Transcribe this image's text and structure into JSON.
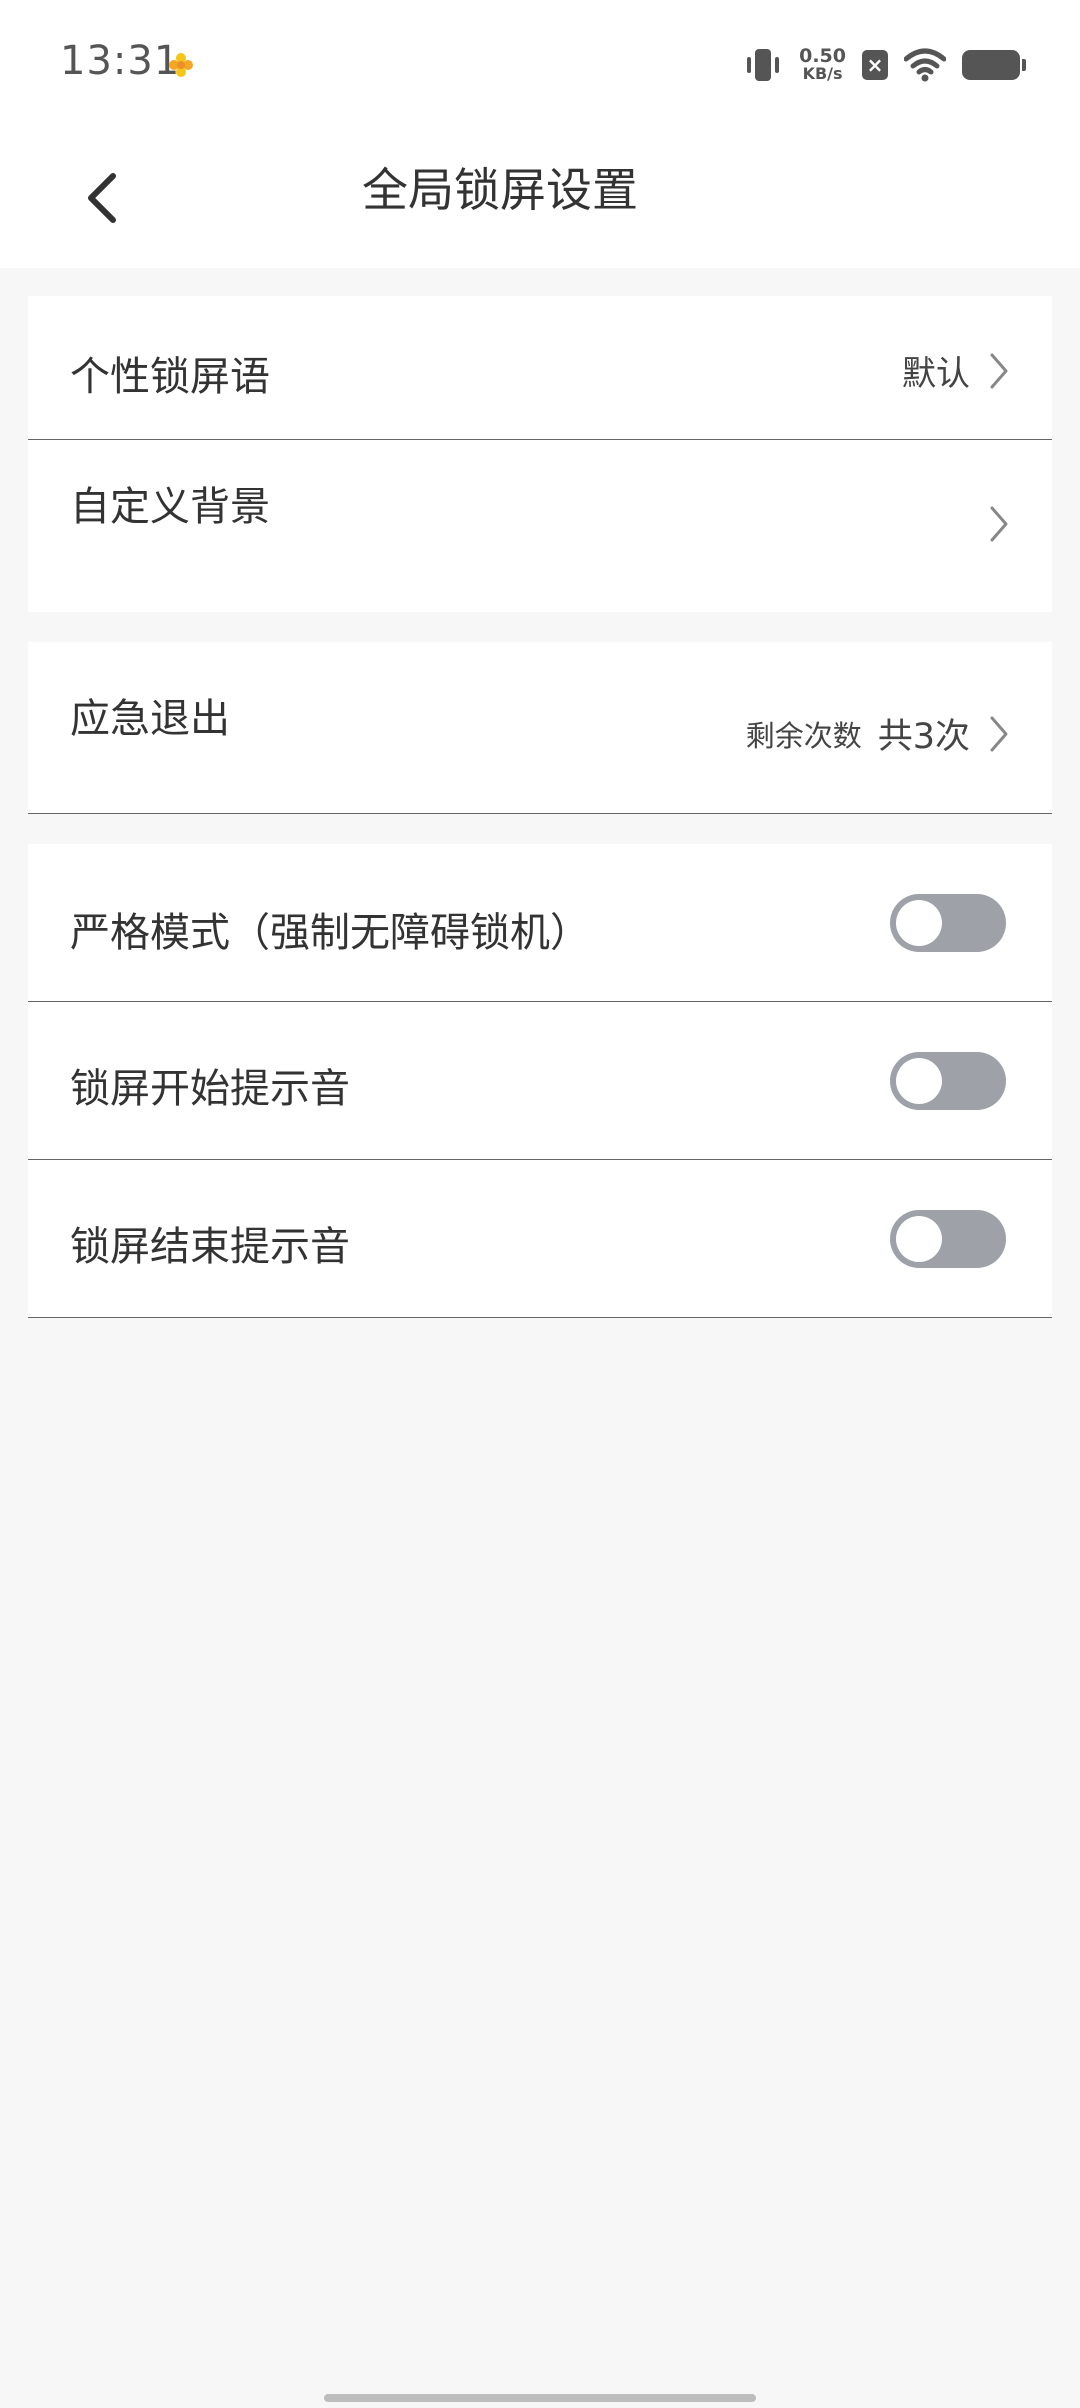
{
  "status_bar": {
    "time": "13:31",
    "net_speed_value": "0.50",
    "net_speed_unit": "KB/s",
    "x_badge": "×"
  },
  "header": {
    "title": "全局锁屏设置"
  },
  "settings": {
    "personal_message": {
      "label": "个性锁屏语",
      "value": "默认"
    },
    "custom_background": {
      "label": "自定义背景"
    },
    "emergency_exit": {
      "label": "应急退出",
      "remaining_label": "剩余次数",
      "count_text": "共3次"
    },
    "strict_mode": {
      "label": "严格模式（强制无障碍锁机）",
      "enabled": false
    },
    "lock_start_sound": {
      "label": "锁屏开始提示音",
      "enabled": false
    },
    "lock_end_sound": {
      "label": "锁屏结束提示音",
      "enabled": false
    }
  },
  "colors": {
    "toggle_off": "#9ea1a7",
    "background": "#f7f7f7",
    "card": "#ffffff"
  }
}
